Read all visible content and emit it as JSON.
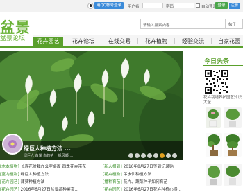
{
  "topbar": {
    "qq_login": "用QQ帐号登录",
    "username_label": "用户名",
    "password_label": "密码",
    "auto_login": "自动登录",
    "login_button": "登录",
    "register_link": "注册"
  },
  "logo": {
    "main": "盆景",
    "sub": "盆景论坛"
  },
  "search": {
    "placeholder": "请输入搜索内容",
    "scope": "帖子"
  },
  "nav": [
    {
      "label": "花卉园艺"
    },
    {
      "label": "花卉论坛"
    },
    {
      "label": "在线交易"
    },
    {
      "label": "花卉植物"
    },
    {
      "label": "经验交流"
    },
    {
      "label": "自家花园"
    }
  ],
  "slider": {
    "caption": "绿巨人种植方法 ...",
    "tags": "绿巨人  白掌  白鹤芋  一帆风顺  ...",
    "slides": 8,
    "active_slide": 6
  },
  "sidebar": {
    "title": "今日头条",
    "text": "花卉栽培养护园艺知识大全"
  },
  "news": {
    "left": [
      {
        "cat": "[木本植物]",
        "title": "长寿花盆栽办公室桌面 四季花卉带花"
      },
      {
        "cat": "[室内植物]",
        "title": "绿巨人种植方法"
      },
      {
        "cat": "[花卉园艺]",
        "title": "蒲葵种植方法"
      },
      {
        "cat": "[花卉园艺]",
        "title": "2016年6月27日盆景品种鉴赏..."
      }
    ],
    "right": [
      {
        "cat": "[新人报到]",
        "title": "2016年8月27日签到记录贴"
      },
      {
        "cat": "[花卉植物]",
        "title": "吊水仙种植方法"
      },
      {
        "cat": "[播种育苗]",
        "title": "花卉、蔬菜种子如何育苗"
      },
      {
        "cat": "[花卉园艺]",
        "title": "2016年6月27日花卉种植心得..."
      }
    ]
  },
  "colors": {
    "brand": "#5aa02c",
    "qq_blue": "#3b8bd9"
  }
}
